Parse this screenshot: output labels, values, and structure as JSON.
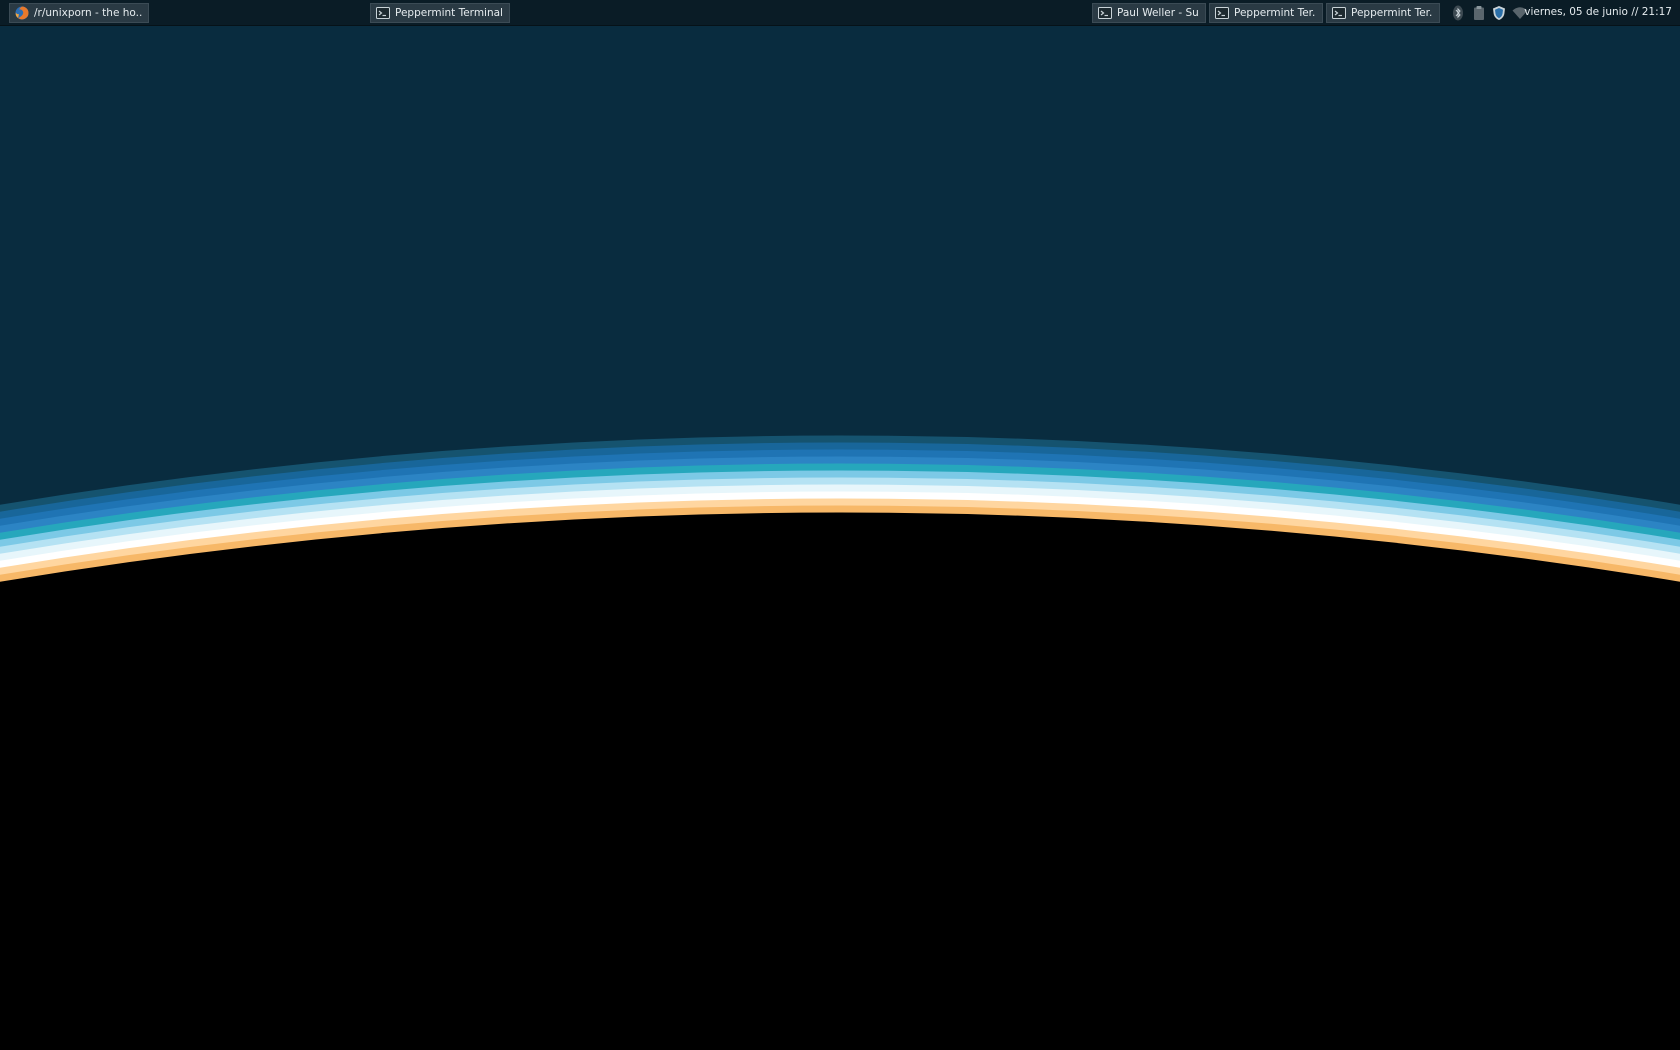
{
  "panel": {
    "tasks": [
      {
        "label": "/r/unixporn - the ho...",
        "icon": "firefox-icon"
      },
      {
        "label": "Peppermint Terminal",
        "icon": "terminal-icon"
      },
      {
        "label": "Paul Weller - Su...",
        "icon": "terminal-icon"
      },
      {
        "label": "Peppermint Ter...",
        "icon": "terminal-icon"
      },
      {
        "label": "Peppermint Ter...",
        "icon": "terminal-icon"
      }
    ],
    "tray": {
      "icons": [
        "bluetooth-icon",
        "clipboard-icon",
        "shield-icon",
        "wifi-icon"
      ]
    },
    "clock": "viernes, 05 de junio // 21:17"
  },
  "colors": {
    "sky": "#092c3f",
    "panel": "#0a1c26",
    "task_bg": "#2a3a44",
    "text": "#e6ecef",
    "planet": "#000000",
    "atmosphere": [
      "#15536f",
      "#18669a",
      "#1f74b4",
      "#2c84c4",
      "#26a7bc",
      "#7cc9e6",
      "#b5e2f3",
      "#e7f6fb",
      "#ffffff",
      "#ffd6a0",
      "#f7b868"
    ]
  }
}
